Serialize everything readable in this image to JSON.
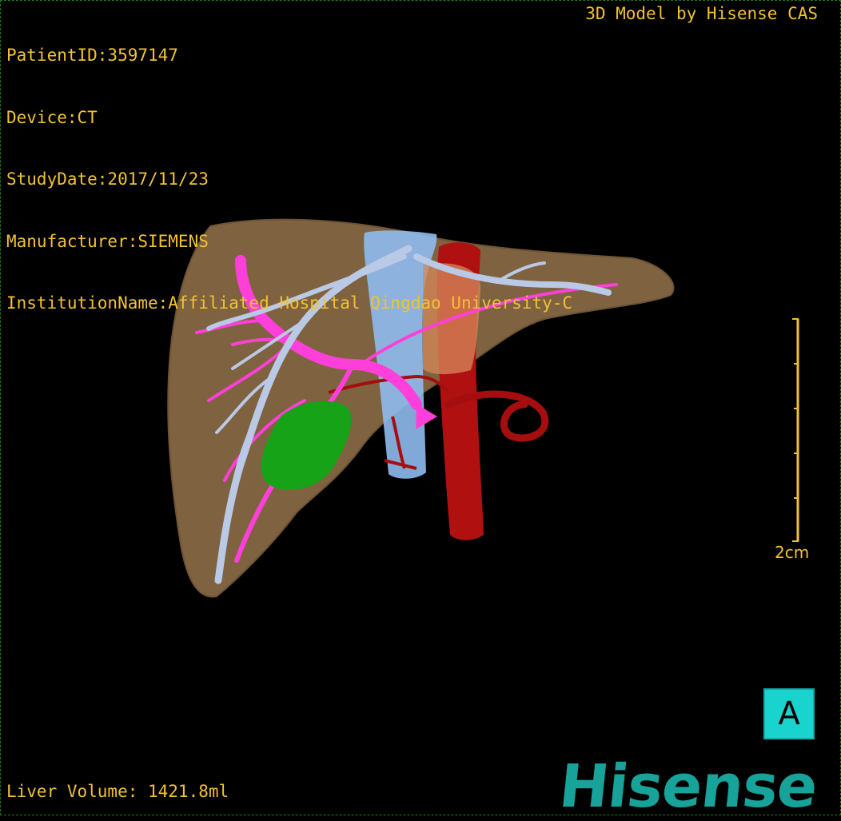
{
  "overlay": {
    "patient_id": "PatientID:3597147",
    "device": "Device:CT",
    "study_date": "StudyDate:2017/11/23",
    "manufacturer": "Manufacturer:SIEMENS",
    "institution": "InstitutionName:Affiliated Hospital Qingdao University-C",
    "credit": "3D Model by Hisense CAS",
    "liver_volume": "Liver Volume: 1421.8ml"
  },
  "scale": {
    "label": "2cm"
  },
  "orientation": {
    "label": "A"
  },
  "brand": {
    "logo_text": "Hisense"
  },
  "colors": {
    "overlay_text": "#f2c233",
    "liver": "#8a6a44",
    "portal_vein": "#ff3fd9",
    "hepatic_vein": "#b9c9e6",
    "ivc": "#8fbbf0",
    "aorta": "#b01010",
    "tumor": "#17a317",
    "orientation_bg": "#19d3cf",
    "logo": "#17a39a"
  }
}
